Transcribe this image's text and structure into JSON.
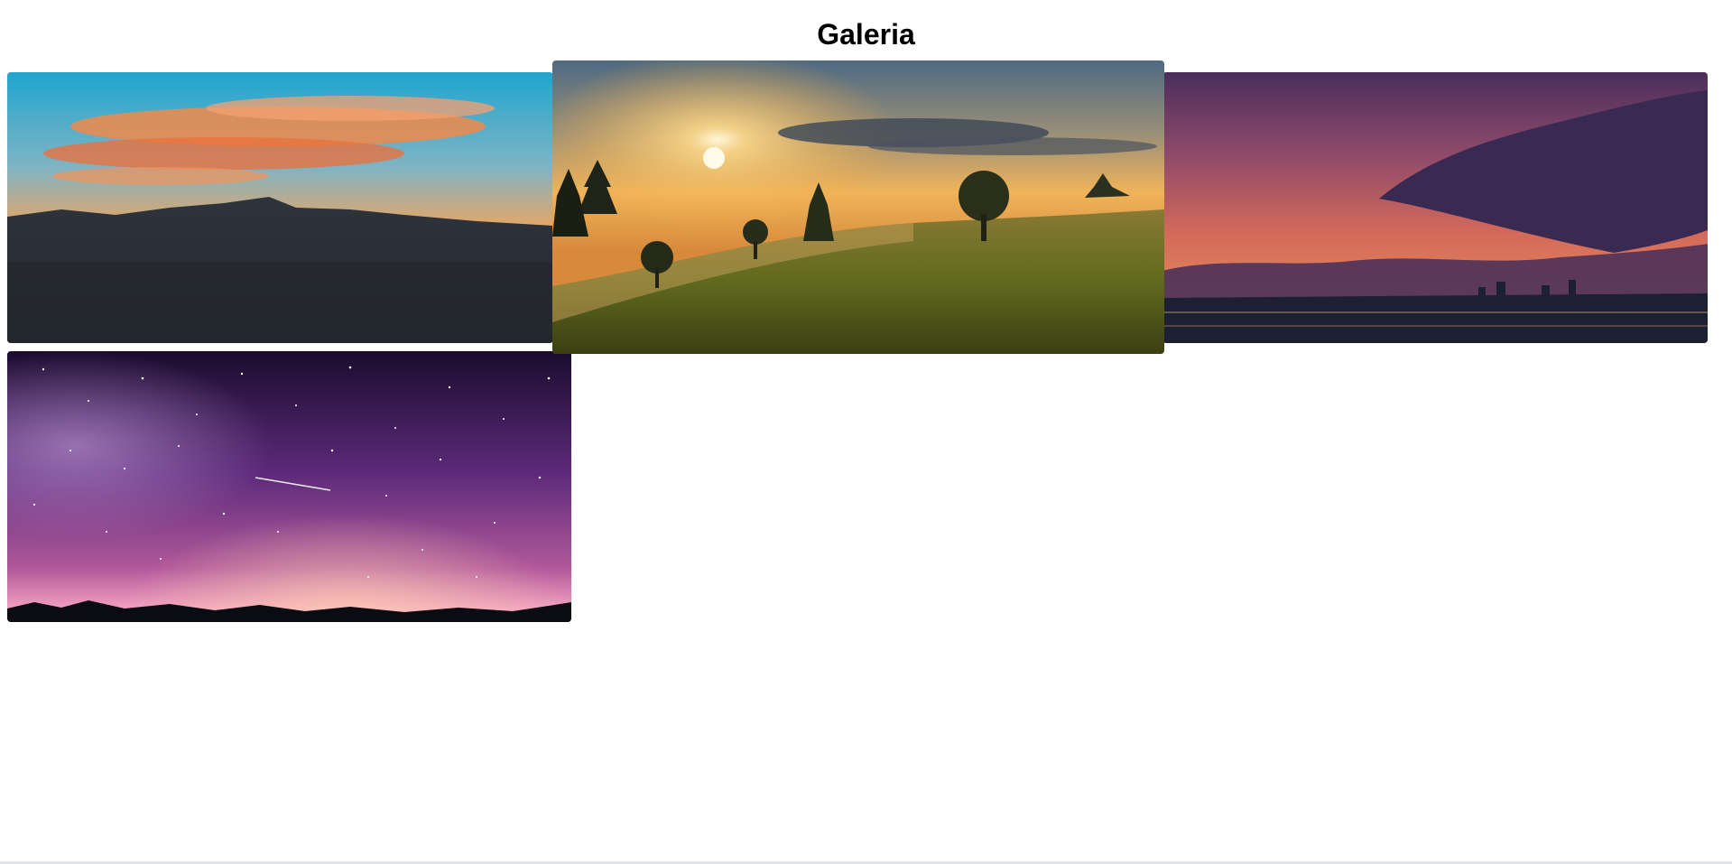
{
  "page": {
    "title": "Galeria"
  },
  "gallery": {
    "images": [
      {
        "icon": "mountain-sunset-photo",
        "colors": {
          "sky_top": "#1fa5cf",
          "sky_bottom": "#f07a2c",
          "clouds": "#f08a4a",
          "land": "#2a2f36"
        }
      },
      {
        "icon": "meadow-sunrise-photo",
        "colors": {
          "sky_top": "#4e6a82",
          "sun": "#fff6d8",
          "glow": "#f5a83a",
          "grass": "#5f6a1e"
        }
      },
      {
        "icon": "city-dusk-photo",
        "colors": {
          "sky_top": "#4a2e5c",
          "sky_mid": "#d46a5a",
          "cloud": "#3a2a52",
          "city": "#1d1f33"
        }
      },
      {
        "icon": "starry-night-photo",
        "colors": {
          "sky_top": "#1a0c2e",
          "sky_mid": "#5c2a7a",
          "horizon": "#f1a0c0",
          "ground": "#0b0b12"
        }
      }
    ]
  }
}
